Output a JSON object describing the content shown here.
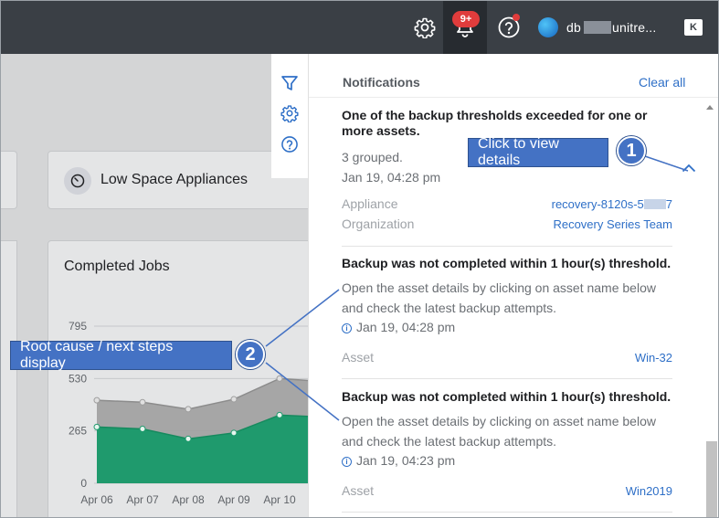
{
  "topbar": {
    "notification_count": "9+",
    "user_name": "db",
    "user_domain": "unitre...",
    "brand_mark": "K",
    "icons": [
      "gear-icon",
      "bell-icon",
      "help-icon",
      "avatar",
      "brand-logo"
    ]
  },
  "dashboard": {
    "low_space_card": {
      "title": "Low Space Appliances",
      "icon": "gauge-icon"
    },
    "jobs_card": {
      "title": "Completed Jobs"
    }
  },
  "chart_data": {
    "type": "area",
    "title": "Completed Jobs",
    "categories": [
      "Apr 06",
      "Apr 07",
      "Apr 08",
      "Apr 09",
      "Apr 10"
    ],
    "yticks": [
      "795",
      "530",
      "265",
      "0"
    ],
    "ylim": [
      0,
      795
    ],
    "series": [
      {
        "values": [
          420,
          410,
          375,
          425,
          530
        ],
        "color": "#9e9e9e"
      },
      {
        "values": [
          285,
          275,
          225,
          255,
          345
        ],
        "color": "#1f9a6d"
      }
    ],
    "grid": true
  },
  "side_panel": {
    "icons": [
      "filter-icon",
      "settings-icon",
      "help-icon"
    ]
  },
  "notifications": {
    "title": "Notifications",
    "clear_all": "Clear all",
    "items": [
      {
        "headline": "One of the backup thresholds exceeded for one or more assets.",
        "grouped": "3 grouped.",
        "time": "Jan 19, 04:28 pm",
        "appliance_label": "Appliance",
        "appliance_value_a": "recovery-8120s-5",
        "appliance_value_b": "7",
        "organization_label": "Organization",
        "organization_value": "Recovery Series Team"
      },
      {
        "headline": "Backup was not completed within 1 hour(s) threshold.",
        "body": "Open the asset details by clicking on asset name below and check the latest backup attempts.",
        "time": "Jan 19, 04:28 pm",
        "asset_label": "Asset",
        "asset_value": "Win-32"
      },
      {
        "headline": "Backup was not completed within 1 hour(s) threshold.",
        "body": "Open the asset details by clicking on asset name below and check the latest backup attempts.",
        "time": "Jan 19, 04:23 pm",
        "asset_label": "Asset",
        "asset_value": "Win2019"
      }
    ]
  },
  "callouts": [
    {
      "number": "1",
      "text": "Click to view details"
    },
    {
      "number": "2",
      "text": "Root cause / next steps display"
    }
  ],
  "colors": {
    "topbar": "#3a3f45",
    "link": "#2e6fc7",
    "callout": "#4472c4",
    "badge": "#e03c3c"
  }
}
